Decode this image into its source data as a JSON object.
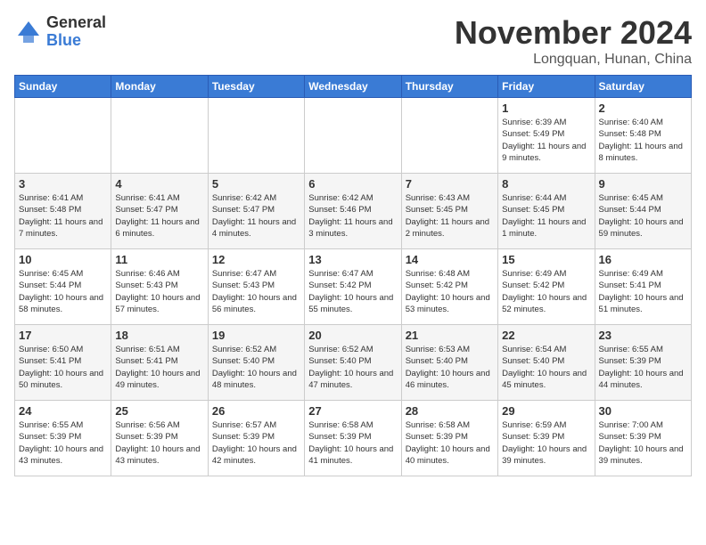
{
  "logo": {
    "general": "General",
    "blue": "Blue"
  },
  "title": "November 2024",
  "location": "Longquan, Hunan, China",
  "days_of_week": [
    "Sunday",
    "Monday",
    "Tuesday",
    "Wednesday",
    "Thursday",
    "Friday",
    "Saturday"
  ],
  "weeks": [
    [
      {
        "day": "",
        "info": ""
      },
      {
        "day": "",
        "info": ""
      },
      {
        "day": "",
        "info": ""
      },
      {
        "day": "",
        "info": ""
      },
      {
        "day": "",
        "info": ""
      },
      {
        "day": "1",
        "info": "Sunrise: 6:39 AM\nSunset: 5:49 PM\nDaylight: 11 hours and 9 minutes."
      },
      {
        "day": "2",
        "info": "Sunrise: 6:40 AM\nSunset: 5:48 PM\nDaylight: 11 hours and 8 minutes."
      }
    ],
    [
      {
        "day": "3",
        "info": "Sunrise: 6:41 AM\nSunset: 5:48 PM\nDaylight: 11 hours and 7 minutes."
      },
      {
        "day": "4",
        "info": "Sunrise: 6:41 AM\nSunset: 5:47 PM\nDaylight: 11 hours and 6 minutes."
      },
      {
        "day": "5",
        "info": "Sunrise: 6:42 AM\nSunset: 5:47 PM\nDaylight: 11 hours and 4 minutes."
      },
      {
        "day": "6",
        "info": "Sunrise: 6:42 AM\nSunset: 5:46 PM\nDaylight: 11 hours and 3 minutes."
      },
      {
        "day": "7",
        "info": "Sunrise: 6:43 AM\nSunset: 5:45 PM\nDaylight: 11 hours and 2 minutes."
      },
      {
        "day": "8",
        "info": "Sunrise: 6:44 AM\nSunset: 5:45 PM\nDaylight: 11 hours and 1 minute."
      },
      {
        "day": "9",
        "info": "Sunrise: 6:45 AM\nSunset: 5:44 PM\nDaylight: 10 hours and 59 minutes."
      }
    ],
    [
      {
        "day": "10",
        "info": "Sunrise: 6:45 AM\nSunset: 5:44 PM\nDaylight: 10 hours and 58 minutes."
      },
      {
        "day": "11",
        "info": "Sunrise: 6:46 AM\nSunset: 5:43 PM\nDaylight: 10 hours and 57 minutes."
      },
      {
        "day": "12",
        "info": "Sunrise: 6:47 AM\nSunset: 5:43 PM\nDaylight: 10 hours and 56 minutes."
      },
      {
        "day": "13",
        "info": "Sunrise: 6:47 AM\nSunset: 5:42 PM\nDaylight: 10 hours and 55 minutes."
      },
      {
        "day": "14",
        "info": "Sunrise: 6:48 AM\nSunset: 5:42 PM\nDaylight: 10 hours and 53 minutes."
      },
      {
        "day": "15",
        "info": "Sunrise: 6:49 AM\nSunset: 5:42 PM\nDaylight: 10 hours and 52 minutes."
      },
      {
        "day": "16",
        "info": "Sunrise: 6:49 AM\nSunset: 5:41 PM\nDaylight: 10 hours and 51 minutes."
      }
    ],
    [
      {
        "day": "17",
        "info": "Sunrise: 6:50 AM\nSunset: 5:41 PM\nDaylight: 10 hours and 50 minutes."
      },
      {
        "day": "18",
        "info": "Sunrise: 6:51 AM\nSunset: 5:41 PM\nDaylight: 10 hours and 49 minutes."
      },
      {
        "day": "19",
        "info": "Sunrise: 6:52 AM\nSunset: 5:40 PM\nDaylight: 10 hours and 48 minutes."
      },
      {
        "day": "20",
        "info": "Sunrise: 6:52 AM\nSunset: 5:40 PM\nDaylight: 10 hours and 47 minutes."
      },
      {
        "day": "21",
        "info": "Sunrise: 6:53 AM\nSunset: 5:40 PM\nDaylight: 10 hours and 46 minutes."
      },
      {
        "day": "22",
        "info": "Sunrise: 6:54 AM\nSunset: 5:40 PM\nDaylight: 10 hours and 45 minutes."
      },
      {
        "day": "23",
        "info": "Sunrise: 6:55 AM\nSunset: 5:39 PM\nDaylight: 10 hours and 44 minutes."
      }
    ],
    [
      {
        "day": "24",
        "info": "Sunrise: 6:55 AM\nSunset: 5:39 PM\nDaylight: 10 hours and 43 minutes."
      },
      {
        "day": "25",
        "info": "Sunrise: 6:56 AM\nSunset: 5:39 PM\nDaylight: 10 hours and 43 minutes."
      },
      {
        "day": "26",
        "info": "Sunrise: 6:57 AM\nSunset: 5:39 PM\nDaylight: 10 hours and 42 minutes."
      },
      {
        "day": "27",
        "info": "Sunrise: 6:58 AM\nSunset: 5:39 PM\nDaylight: 10 hours and 41 minutes."
      },
      {
        "day": "28",
        "info": "Sunrise: 6:58 AM\nSunset: 5:39 PM\nDaylight: 10 hours and 40 minutes."
      },
      {
        "day": "29",
        "info": "Sunrise: 6:59 AM\nSunset: 5:39 PM\nDaylight: 10 hours and 39 minutes."
      },
      {
        "day": "30",
        "info": "Sunrise: 7:00 AM\nSunset: 5:39 PM\nDaylight: 10 hours and 39 minutes."
      }
    ]
  ]
}
